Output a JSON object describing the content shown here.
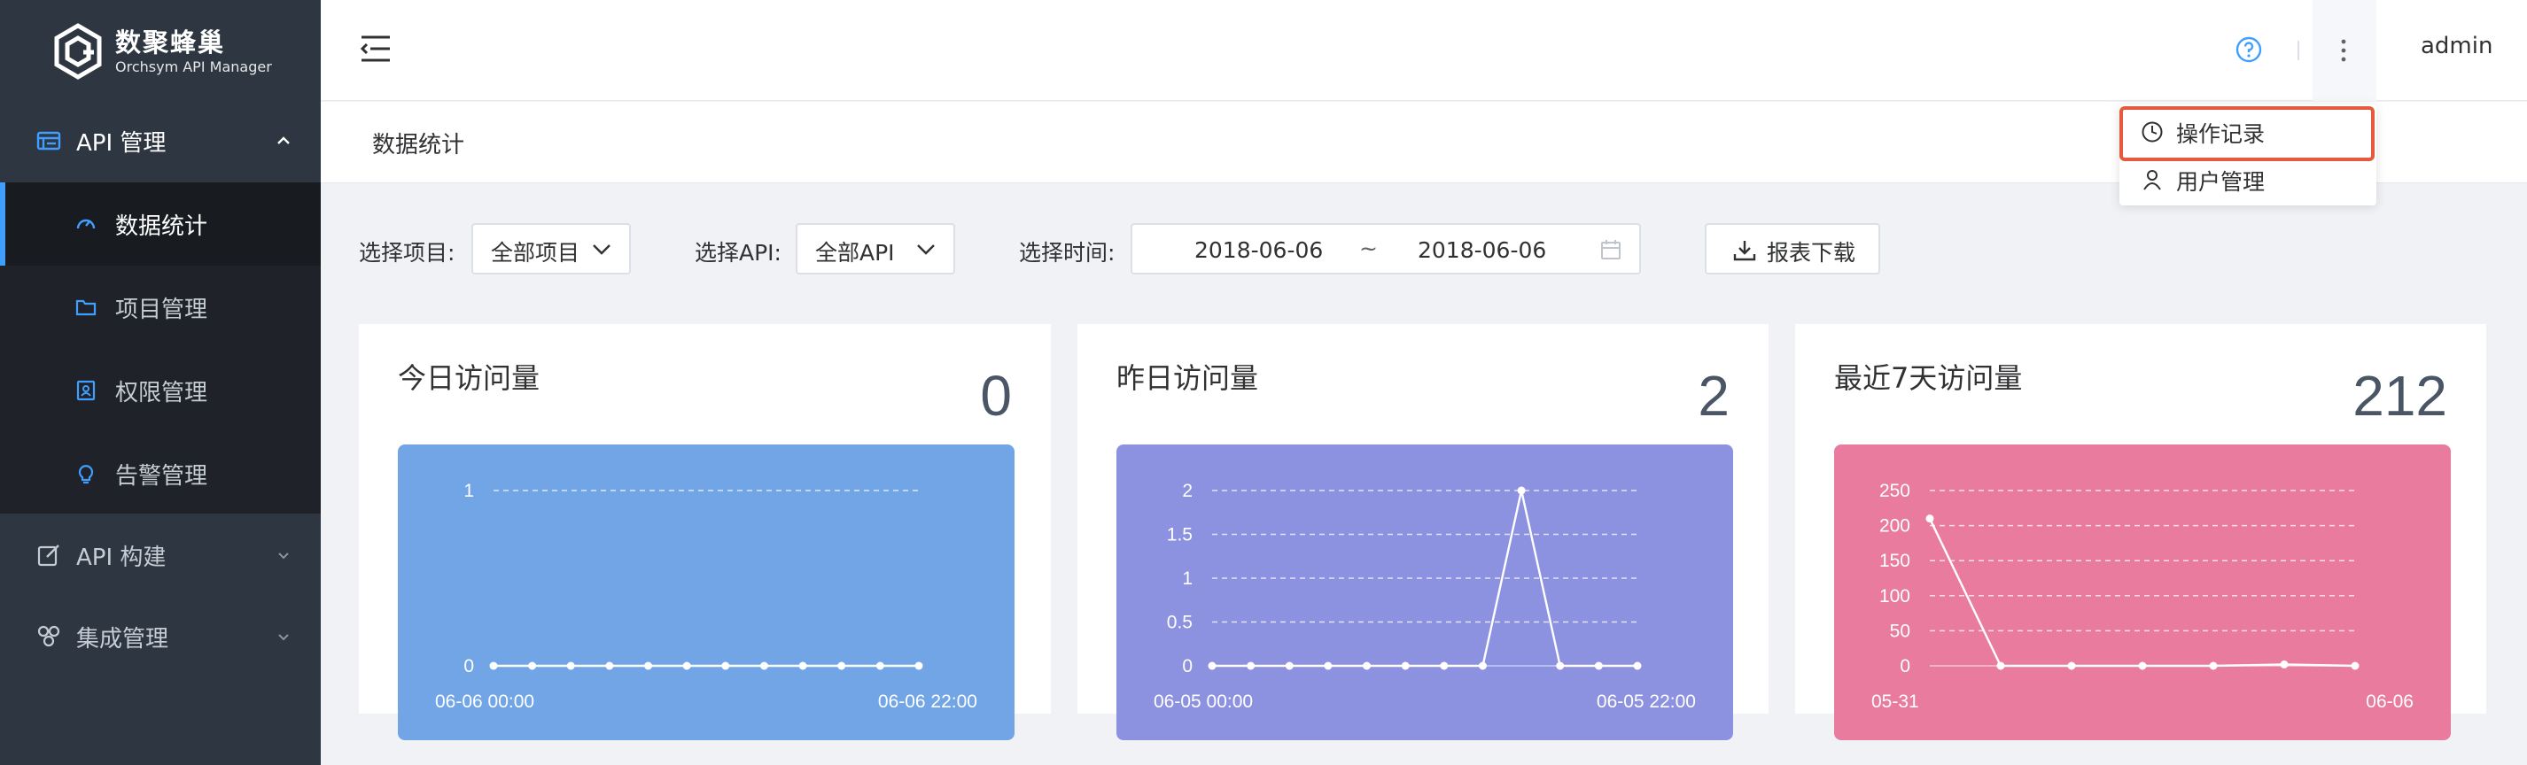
{
  "app": {
    "logo_title": "数聚蜂巢",
    "logo_subtitle": "Orchsym API Manager"
  },
  "sidebar": {
    "groups": [
      {
        "label": "API 管理",
        "icon": "api-list-icon",
        "expanded": true,
        "items": [
          {
            "label": "数据统计",
            "icon": "dashboard-gauge-icon",
            "active": true
          },
          {
            "label": "项目管理",
            "icon": "folder-icon"
          },
          {
            "label": "权限管理",
            "icon": "permission-icon"
          },
          {
            "label": "告警管理",
            "icon": "lightbulb-icon"
          }
        ]
      },
      {
        "label": "API 构建",
        "icon": "edit-icon",
        "expanded": false
      },
      {
        "label": "集成管理",
        "icon": "integration-icon",
        "expanded": false
      }
    ]
  },
  "header": {
    "user": "admin",
    "help_icon": "help-circle-icon",
    "more_icon": "more-vertical-icon"
  },
  "dropdown": {
    "items": [
      {
        "label": "操作记录",
        "icon": "clock-icon"
      },
      {
        "label": "用户管理",
        "icon": "user-icon"
      }
    ]
  },
  "breadcrumb": "数据统计",
  "filters": {
    "project_label": "选择项目:",
    "project_value": "全部项目",
    "api_label": "选择API:",
    "api_value": "全部API",
    "time_label": "选择时间:",
    "start_date": "2018-06-06",
    "range_separator": "~",
    "end_date": "2018-06-06",
    "download_label": "报表下载"
  },
  "cards": [
    {
      "title": "今日访问量",
      "value": "0",
      "color": "#71a5e6"
    },
    {
      "title": "昨日访问量",
      "value": "2",
      "color": "#8c91e0"
    },
    {
      "title": "最近7天访问量",
      "value": "212",
      "color": "#e97c9e"
    }
  ],
  "chart_data": [
    {
      "type": "line",
      "x_first_label": "06-06 00:00",
      "x_last_label": "06-06 22:00",
      "yticks": [
        "0",
        "1"
      ],
      "ylim": [
        0,
        1
      ],
      "grid": true,
      "series": [
        {
          "values": [
            0,
            0,
            0,
            0,
            0,
            0,
            0,
            0,
            0,
            0,
            0,
            0
          ]
        }
      ]
    },
    {
      "type": "line",
      "x_first_label": "06-05 00:00",
      "x_last_label": "06-05 22:00",
      "yticks": [
        "0",
        "0.5",
        "1",
        "1.5",
        "2"
      ],
      "ylim": [
        0,
        2
      ],
      "grid": true,
      "series": [
        {
          "values": [
            0,
            0,
            0,
            0,
            0,
            0,
            0,
            0,
            2,
            0,
            0,
            0
          ]
        }
      ]
    },
    {
      "type": "line",
      "x_first_label": "05-31",
      "x_last_label": "06-06",
      "yticks": [
        "0",
        "50",
        "100",
        "150",
        "200",
        "250"
      ],
      "ylim": [
        0,
        250
      ],
      "grid": true,
      "series": [
        {
          "values": [
            210,
            0,
            0,
            0,
            0,
            2,
            0
          ]
        }
      ]
    }
  ]
}
